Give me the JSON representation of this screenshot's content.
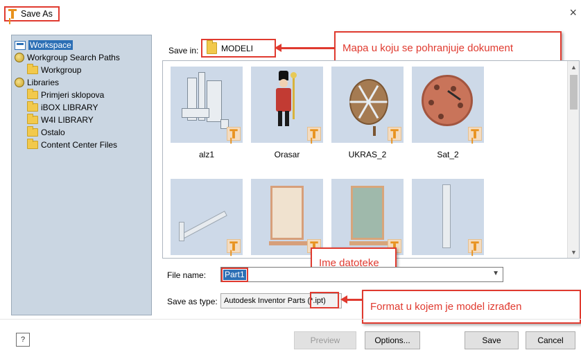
{
  "window": {
    "title": "Save As",
    "close_glyph": "×"
  },
  "tree": {
    "items": [
      {
        "label": "Workspace",
        "icon": "workspace-icon",
        "selected": true
      },
      {
        "label": "Workgroup Search Paths",
        "icon": "globe-icon"
      },
      {
        "label": "Workgroup",
        "icon": "folder-icon"
      },
      {
        "label": "Libraries",
        "icon": "globe-icon"
      },
      {
        "label": "Primjeri sklopova",
        "icon": "folder-icon"
      },
      {
        "label": "iBOX LIBRARY",
        "icon": "folder-icon"
      },
      {
        "label": "W4I LIBRARY",
        "icon": "folder-icon"
      },
      {
        "label": "Ostalo",
        "icon": "folder-icon"
      },
      {
        "label": "Content Center Files",
        "icon": "folder-icon"
      }
    ]
  },
  "save_in": {
    "label": "Save in:",
    "value": "MODELI"
  },
  "callouts": {
    "save_in_note": "Mapa u koju se pohranjuje dokument",
    "file_name_note": "Ime datoteke",
    "format_note": "Format u kojem je model izrađen"
  },
  "files": [
    {
      "name": "alz1"
    },
    {
      "name": "Orasar"
    },
    {
      "name": "UKRAS_2"
    },
    {
      "name": "Sat_2"
    }
  ],
  "file_name": {
    "label": "File name:",
    "value": "Part1"
  },
  "save_as_type": {
    "label": "Save as type:",
    "value": "Autodesk Inventor Parts (*.ipt)"
  },
  "buttons": {
    "help": "?",
    "preview": "Preview",
    "options": "Options...",
    "save": "Save",
    "cancel": "Cancel"
  },
  "colors": {
    "annotation_red": "#e03a2f",
    "selection_blue": "#2c6fb5",
    "tree_background": "#cad6e2",
    "inventor_orange": "#e8921e"
  }
}
